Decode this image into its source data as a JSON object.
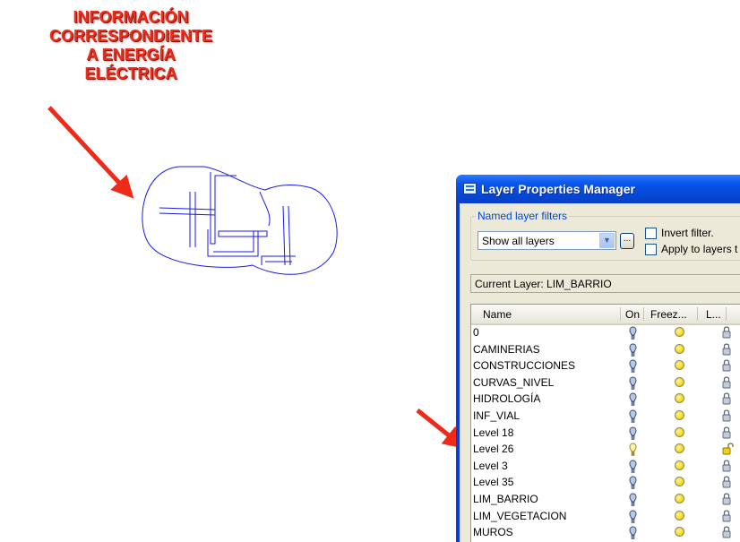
{
  "annotation": {
    "lines": [
      "INFORMACIÓN",
      "CORRESPONDIENTE",
      "A ENERGÍA",
      "ELÉCTRICA"
    ],
    "color": "#f22c1a"
  },
  "window": {
    "title": "Layer Properties Manager",
    "filters_group_label": "Named layer filters",
    "filter_value": "Show all layers",
    "dots_label": "...",
    "invert_filter_label": "Invert filter.",
    "apply_label": "Apply to layers t",
    "current_layer": "Current Layer:  LIM_BARRIO",
    "columns": [
      "Name",
      "On",
      "Freez...",
      "L..."
    ],
    "layers": [
      {
        "name": "0",
        "on": true,
        "locked": true
      },
      {
        "name": "CAMINERIAS",
        "on": true,
        "locked": true
      },
      {
        "name": "CONSTRUCCIONES",
        "on": true,
        "locked": true
      },
      {
        "name": "CURVAS_NIVEL",
        "on": true,
        "locked": true
      },
      {
        "name": "HIDROLOGÍA",
        "on": true,
        "locked": true
      },
      {
        "name": "INF_VIAL",
        "on": true,
        "locked": true
      },
      {
        "name": "Level 18",
        "on": true,
        "locked": true
      },
      {
        "name": "Level 26",
        "on": false,
        "locked": false
      },
      {
        "name": "Level 3",
        "on": true,
        "locked": true
      },
      {
        "name": "Level 35",
        "on": true,
        "locked": true
      },
      {
        "name": "LIM_BARRIO",
        "on": true,
        "locked": true
      },
      {
        "name": "LIM_VEGETACION",
        "on": true,
        "locked": true
      },
      {
        "name": "MUROS",
        "on": true,
        "locked": true
      }
    ]
  },
  "colors": {
    "arrow": "#ee2a18",
    "drawing": "#1a1ae8",
    "titlebar": "#0a55ec"
  },
  "icons": {
    "bulb_on": "lightbulb-on-icon",
    "bulb_off": "lightbulb-off-icon",
    "freeze": "sun-icon",
    "lock": "padlock-icon"
  }
}
